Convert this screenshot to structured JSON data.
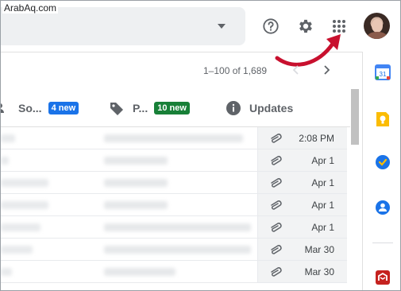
{
  "watermark": {
    "text": "ArabAq.com"
  },
  "header": {
    "help_icon": "help-circle-icon",
    "settings_icon": "gear-icon",
    "apps_icon": "apps-grid-icon"
  },
  "toolbar": {
    "pagination": "1–100 of 1,689"
  },
  "tabs": [
    {
      "label": "So...",
      "badge": "4 new",
      "badge_color": "#1a73e8",
      "icon": "people-icon"
    },
    {
      "label": "P...",
      "badge": "10 new",
      "badge_color": "#188038",
      "icon": "tag-icon"
    },
    {
      "label": "Updates",
      "icon": "info-icon"
    }
  ],
  "emails": [
    {
      "date": "2:08 PM",
      "has_attachment": true
    },
    {
      "date": "Apr 1",
      "has_attachment": true
    },
    {
      "date": "Apr 1",
      "has_attachment": true
    },
    {
      "date": "Apr 1",
      "has_attachment": true
    },
    {
      "date": "Apr 1",
      "has_attachment": true
    },
    {
      "date": "Mar 30",
      "has_attachment": true
    },
    {
      "date": "Mar 30",
      "has_attachment": true
    }
  ],
  "side_panel": {
    "apps": [
      "calendar-icon",
      "keep-icon",
      "tasks-icon",
      "contacts-icon",
      "addon-icon"
    ],
    "calendar_day": "31"
  },
  "colors": {
    "arrow": "#c8102e",
    "accent_blue": "#1a73e8",
    "accent_green": "#188038"
  }
}
